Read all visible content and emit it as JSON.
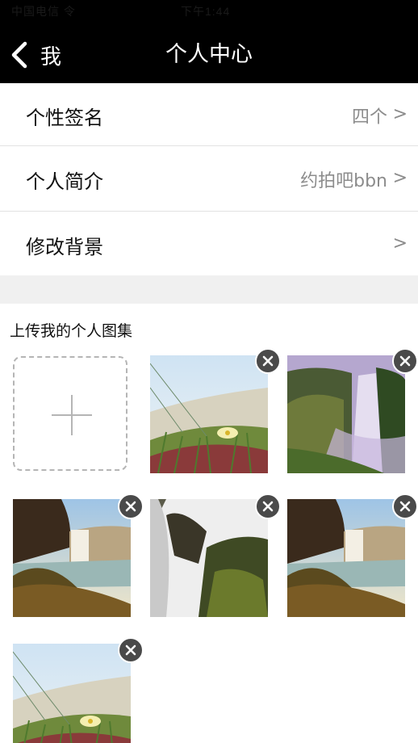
{
  "status_bar": {
    "carrier": "中国电信 令",
    "time": "下午1:44"
  },
  "nav": {
    "back_label": "我",
    "title": "个人中心"
  },
  "settings": [
    {
      "label": "个性签名",
      "value": "四个",
      "chevron": ">"
    },
    {
      "label": "个人简介",
      "value": "约拍吧bbn",
      "chevron": ">"
    },
    {
      "label": "修改背景",
      "value": "",
      "chevron": ">"
    }
  ],
  "gallery": {
    "title": "上传我的个人图集",
    "add_icon": "plus-icon",
    "photos": [
      {
        "subject": "flower-meadow",
        "delete_icon": "close-icon"
      },
      {
        "subject": "waterfall-cliff",
        "delete_icon": "close-icon"
      },
      {
        "subject": "waterfall-shore",
        "delete_icon": "close-icon"
      },
      {
        "subject": "waterfall-closeup",
        "delete_icon": "close-icon"
      },
      {
        "subject": "waterfall-shore",
        "delete_icon": "close-icon"
      },
      {
        "subject": "flower-meadow",
        "delete_icon": "close-icon"
      }
    ]
  }
}
